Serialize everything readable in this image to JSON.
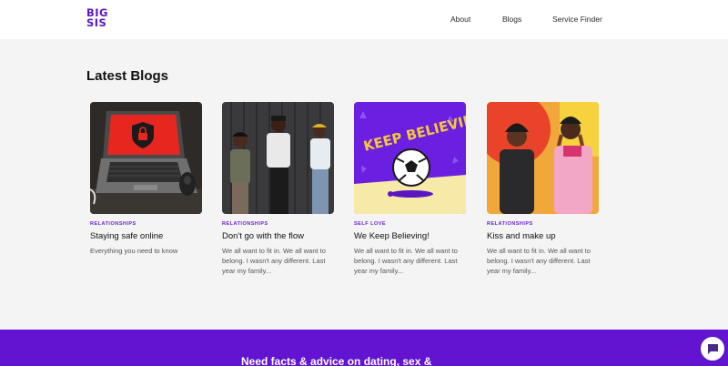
{
  "header": {
    "logo_line1": "BIG",
    "logo_line2": "SIS",
    "nav": [
      "About",
      "Blogs",
      "Service Finder"
    ]
  },
  "main": {
    "section_title": "Latest Blogs",
    "cards": [
      {
        "category": "RELATIONSHIPS",
        "title": "Staying safe online",
        "excerpt": "Everything you need to know",
        "image_icon": "laptop-lock-icon"
      },
      {
        "category": "RELATIONSHIPS",
        "title": "Don't go with the flow",
        "excerpt": "We all want to fit in. We all want to belong. I wasn't any different. Last year my family...",
        "image_icon": "group-photo"
      },
      {
        "category": "SELF LOVE",
        "title": "We Keep Believing!",
        "excerpt": "We all want to fit in. We all want to belong. I wasn't any different. Last year my family...",
        "image_icon": "keep-believing-illustration",
        "image_text": "KEEP BELIEVING!"
      },
      {
        "category": "RELATIONSHIPS",
        "title": "Kiss and make up",
        "excerpt": "We all want to fit in. We all want to belong. I wasn't any different. Last year my family...",
        "image_icon": "friends-photo"
      }
    ]
  },
  "footer": {
    "cta_text": "Need facts & advice on dating, sex &"
  },
  "colors": {
    "brand": "#5b17c4",
    "footer_bg": "#6214d1",
    "page_bg": "#f4f4f4"
  }
}
